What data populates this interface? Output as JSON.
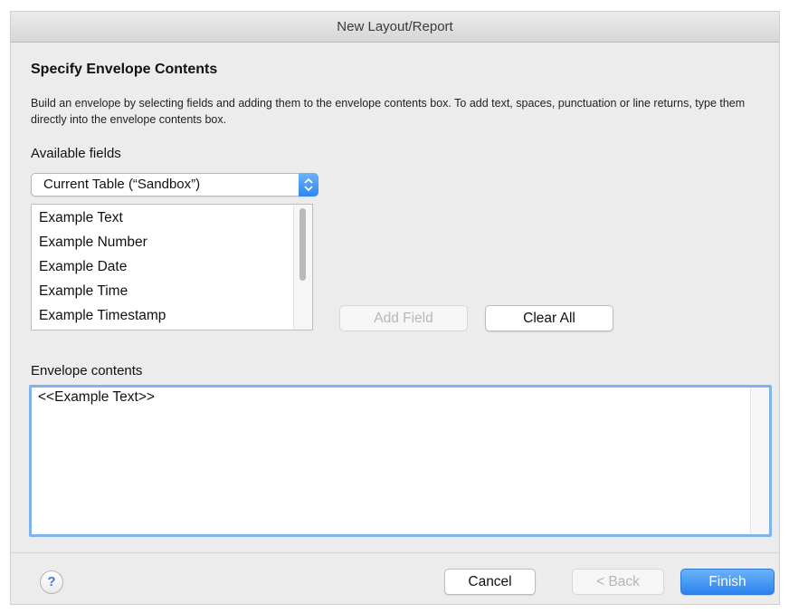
{
  "window": {
    "title": "New Layout/Report"
  },
  "header": {
    "title": "Specify Envelope Contents",
    "description": "Build an envelope by selecting fields and adding them to the envelope contents box. To add text, spaces, punctuation or line returns, type them directly into the envelope contents box."
  },
  "available_fields": {
    "label": "Available fields",
    "table_selector": {
      "value": "Current Table (“Sandbox”)"
    },
    "items": [
      {
        "label": "Example Text"
      },
      {
        "label": "Example Number"
      },
      {
        "label": "Example Date"
      },
      {
        "label": "Example Time"
      },
      {
        "label": "Example Timestamp"
      }
    ]
  },
  "actions": {
    "add_field": "Add Field",
    "clear_all": "Clear All"
  },
  "envelope": {
    "label": "Envelope contents",
    "value": "<<Example Text>>"
  },
  "footer": {
    "help": "?",
    "cancel": "Cancel",
    "back": "< Back",
    "finish": "Finish"
  },
  "colors": {
    "accent": "#2a83ee",
    "focus_ring": "#7fb2ee"
  }
}
